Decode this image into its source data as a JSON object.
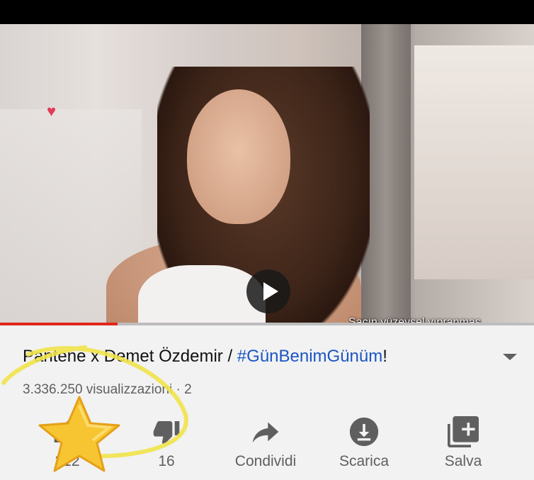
{
  "video": {
    "subtitle": "Saçın yüzeysel yıpranmas",
    "progress_fraction": 0.22
  },
  "info": {
    "title_main": "Pantene x Demet Özdemir / ",
    "title_hashtag": "#GünBenimGünüm",
    "title_end": "!",
    "meta": "3.336.250 visualizzazioni · 2"
  },
  "actions": {
    "like_count": "212",
    "dislike_count": "16",
    "share_label": "Condividi",
    "download_label": "Scarica",
    "save_label": "Salva"
  },
  "colors": {
    "progress": "#e1261c",
    "hashtag": "#1a56c4",
    "highlight": "#f0e34a"
  },
  "icons": {
    "play": "play-icon",
    "heart": "heart-sticker-icon",
    "like": "thumbs-up-icon",
    "dislike": "thumbs-down-icon",
    "share": "share-arrow-icon",
    "download": "download-icon",
    "save": "add-to-playlist-icon",
    "expand": "chevron-down-icon",
    "star": "star-sticker-icon"
  }
}
